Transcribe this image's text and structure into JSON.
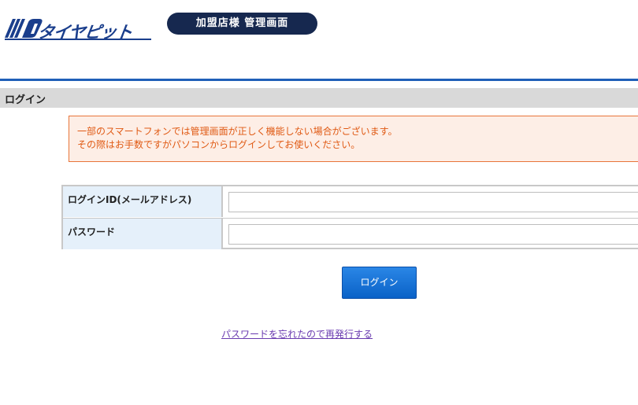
{
  "header": {
    "logo_text": "タイヤピット",
    "badge": "加盟店様 管理画面",
    "colors": {
      "rule": "#1f5fb8",
      "badge_bg": "#16284f",
      "logo": "#1a3e8c"
    }
  },
  "section": {
    "title": "ログイン"
  },
  "notice": {
    "lines": [
      "一部のスマートフォンでは管理画面が正しく機能しない場合がございます。",
      "その際はお手数ですがパソコンからログインしてお使いください。"
    ],
    "colors": {
      "text": "#e05a14",
      "bg": "#fdeee6",
      "border": "#e8753a"
    }
  },
  "form": {
    "fields": [
      {
        "label": "ログインID(メールアドレス)",
        "value": ""
      },
      {
        "label": "パスワード",
        "value": ""
      }
    ]
  },
  "actions": {
    "login_label": "ログイン",
    "reset_link": "パスワードを忘れたので再発行する"
  }
}
